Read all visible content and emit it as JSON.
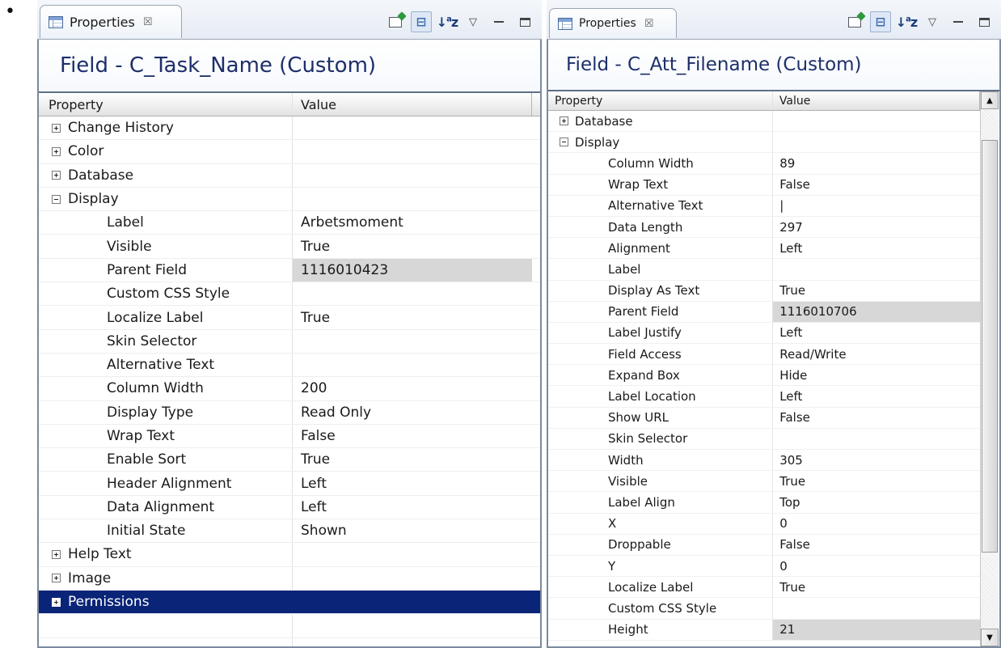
{
  "bullet": "•",
  "left_panel": {
    "tab_label": "Properties",
    "tab_close": "☒",
    "title": "Field - C_Task_Name (Custom)",
    "headers": {
      "property": "Property",
      "value": "Value"
    },
    "rows": [
      {
        "label": "Change History",
        "value": "",
        "type": "group",
        "expanded": false
      },
      {
        "label": "Color",
        "value": "",
        "type": "group",
        "expanded": false
      },
      {
        "label": "Database",
        "value": "",
        "type": "group",
        "expanded": false
      },
      {
        "label": "Display",
        "value": "",
        "type": "group",
        "expanded": true
      },
      {
        "label": "Label",
        "value": "Arbetsmoment",
        "type": "child"
      },
      {
        "label": "Visible",
        "value": "True",
        "type": "child"
      },
      {
        "label": "Parent Field",
        "value": "1116010423",
        "type": "child",
        "grey": true
      },
      {
        "label": "Custom CSS Style",
        "value": "",
        "type": "child"
      },
      {
        "label": "Localize Label",
        "value": "True",
        "type": "child"
      },
      {
        "label": "Skin Selector",
        "value": "",
        "type": "child"
      },
      {
        "label": "Alternative Text",
        "value": "",
        "type": "child"
      },
      {
        "label": "Column Width",
        "value": "200",
        "type": "child"
      },
      {
        "label": "Display Type",
        "value": "Read Only",
        "type": "child"
      },
      {
        "label": "Wrap Text",
        "value": "False",
        "type": "child"
      },
      {
        "label": "Enable Sort",
        "value": "True",
        "type": "child"
      },
      {
        "label": "Header Alignment",
        "value": "Left",
        "type": "child"
      },
      {
        "label": "Data Alignment",
        "value": "Left",
        "type": "child"
      },
      {
        "label": "Initial State",
        "value": "Shown",
        "type": "child"
      },
      {
        "label": "Help Text",
        "value": "",
        "type": "group",
        "expanded": false
      },
      {
        "label": "Image",
        "value": "",
        "type": "group",
        "expanded": false
      },
      {
        "label": "Permissions",
        "value": "",
        "type": "group",
        "expanded": false,
        "selected": true
      },
      {
        "label": "",
        "value": "",
        "type": "empty"
      },
      {
        "label": "",
        "value": "",
        "type": "empty"
      }
    ]
  },
  "right_panel": {
    "tab_label": "Properties",
    "tab_close": "☒",
    "title": "Field - C_Att_Filename (Custom)",
    "headers": {
      "property": "Property",
      "value": "Value"
    },
    "rows": [
      {
        "label": "Database",
        "value": "",
        "type": "group",
        "expanded": false
      },
      {
        "label": "Display",
        "value": "",
        "type": "group",
        "expanded": true
      },
      {
        "label": "Column Width",
        "value": "89",
        "type": "child"
      },
      {
        "label": "Wrap Text",
        "value": "False",
        "type": "child"
      },
      {
        "label": "Alternative Text",
        "value": "|",
        "type": "child"
      },
      {
        "label": "Data Length",
        "value": "297",
        "type": "child"
      },
      {
        "label": "Alignment",
        "value": "Left",
        "type": "child"
      },
      {
        "label": "Label",
        "value": "",
        "type": "child"
      },
      {
        "label": "Display As Text",
        "value": "True",
        "type": "child"
      },
      {
        "label": "Parent Field",
        "value": "1116010706",
        "type": "child",
        "grey": true
      },
      {
        "label": "Label Justify",
        "value": "Left",
        "type": "child"
      },
      {
        "label": "Field Access",
        "value": "Read/Write",
        "type": "child"
      },
      {
        "label": "Expand Box",
        "value": "Hide",
        "type": "child"
      },
      {
        "label": "Label Location",
        "value": "Left",
        "type": "child"
      },
      {
        "label": "Show URL",
        "value": "False",
        "type": "child"
      },
      {
        "label": "Skin Selector",
        "value": "",
        "type": "child"
      },
      {
        "label": "Width",
        "value": "305",
        "type": "child"
      },
      {
        "label": "Visible",
        "value": "True",
        "type": "child"
      },
      {
        "label": "Label Align",
        "value": "Top",
        "type": "child"
      },
      {
        "label": "X",
        "value": "0",
        "type": "child"
      },
      {
        "label": "Droppable",
        "value": "False",
        "type": "child"
      },
      {
        "label": "Y",
        "value": "0",
        "type": "child"
      },
      {
        "label": "Localize Label",
        "value": "True",
        "type": "child"
      },
      {
        "label": "Custom CSS Style",
        "value": "",
        "type": "child"
      },
      {
        "label": "Height",
        "value": "21",
        "type": "child",
        "grey": true
      }
    ]
  },
  "toolbar": {
    "icons": [
      "pin-to-selection-icon",
      "show-categories-icon",
      "sort-alphabetically-icon",
      "view-menu-icon",
      "minimize-icon",
      "maximize-icon"
    ],
    "sort_glyph": "↓",
    "sort_a": "a",
    "sort_z": "z",
    "menu_glyph": "▽"
  },
  "scrollbar": {
    "up_glyph": "▲",
    "down_glyph": "▼"
  },
  "colors": {
    "selection": "#0a2478",
    "title_text": "#1d2f6a",
    "highlight_grey": "#d7d7d7"
  }
}
